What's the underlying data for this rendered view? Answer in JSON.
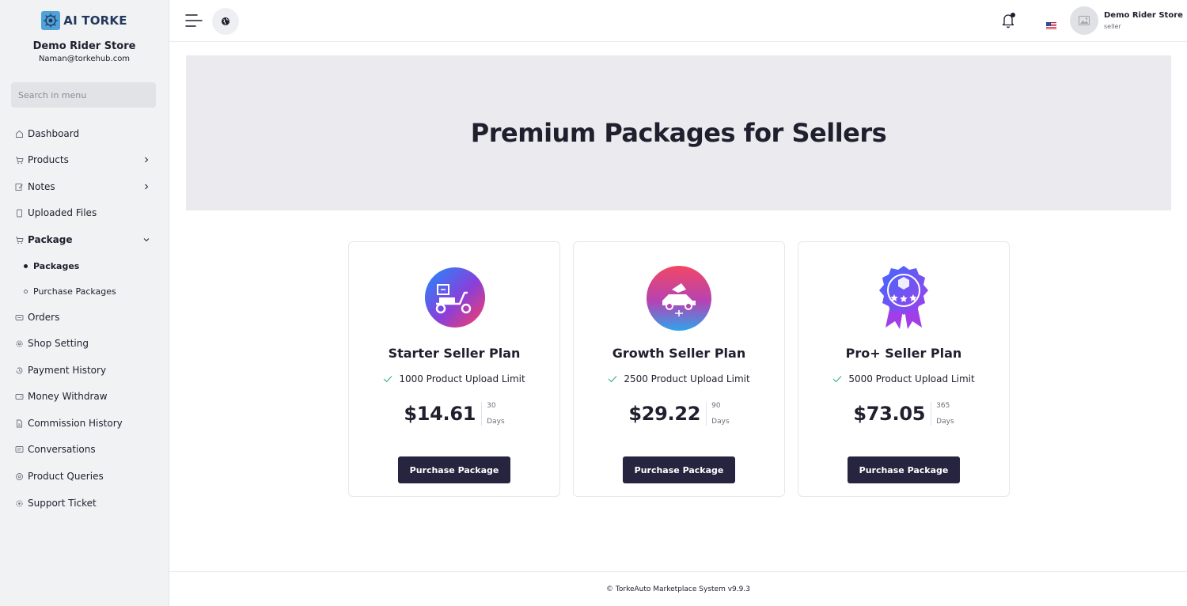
{
  "sidebar": {
    "brand": "AI TORKE",
    "store_name": "Demo Rider Store",
    "store_email": "Naman@torkehub.com",
    "search_placeholder": "Search in menu",
    "items": [
      {
        "label": "Dashboard",
        "icon": "home-icon"
      },
      {
        "label": "Products",
        "icon": "cart-icon"
      },
      {
        "label": "Notes",
        "icon": "note-icon"
      },
      {
        "label": "Uploaded Files",
        "icon": "file-icon"
      },
      {
        "label": "Package",
        "icon": "cart-icon"
      },
      {
        "label": "Orders",
        "icon": "orders-icon"
      },
      {
        "label": "Shop Setting",
        "icon": "gear-icon"
      },
      {
        "label": "Payment History",
        "icon": "history-icon"
      },
      {
        "label": "Money Withdraw",
        "icon": "wallet-icon"
      },
      {
        "label": "Commission History",
        "icon": "document-icon"
      },
      {
        "label": "Conversations",
        "icon": "chat-icon"
      },
      {
        "label": "Product Queries",
        "icon": "question-icon"
      },
      {
        "label": "Support Ticket",
        "icon": "support-icon"
      }
    ],
    "sub_items": [
      {
        "label": "Packages",
        "active": true
      },
      {
        "label": "Purchase Packages",
        "active": false
      }
    ]
  },
  "header": {
    "user_name": "Demo Rider Store",
    "user_role": "seller",
    "notification_dot_color": "#1f1f2e"
  },
  "hero": {
    "title": "Premium Packages for Sellers"
  },
  "packages": [
    {
      "name": "Starter Seller Plan",
      "feature": "1000 Product Upload Limit",
      "price": "$14.61",
      "duration": "30",
      "duration_unit": "Days",
      "button": "Purchase Package",
      "icon": "scooter-delivery-icon"
    },
    {
      "name": "Growth Seller Plan",
      "feature": "2500 Product Upload Limit",
      "price": "$29.22",
      "duration": "90",
      "duration_unit": "Days",
      "button": "Purchase Package",
      "icon": "car-delivery-icon"
    },
    {
      "name": "Pro+ Seller Plan",
      "feature": "5000 Product Upload Limit",
      "price": "$73.05",
      "duration": "365",
      "duration_unit": "Days",
      "button": "Purchase Package",
      "icon": "premium-badge-icon"
    }
  ],
  "footer": {
    "text": "© TorkeAuto Marketplace System v9.9.3"
  },
  "colors": {
    "accent": "#26243f",
    "check": "#3bb77e",
    "sidebar_bg": "#f1f2f4",
    "hero_bg": "#ebebef"
  }
}
